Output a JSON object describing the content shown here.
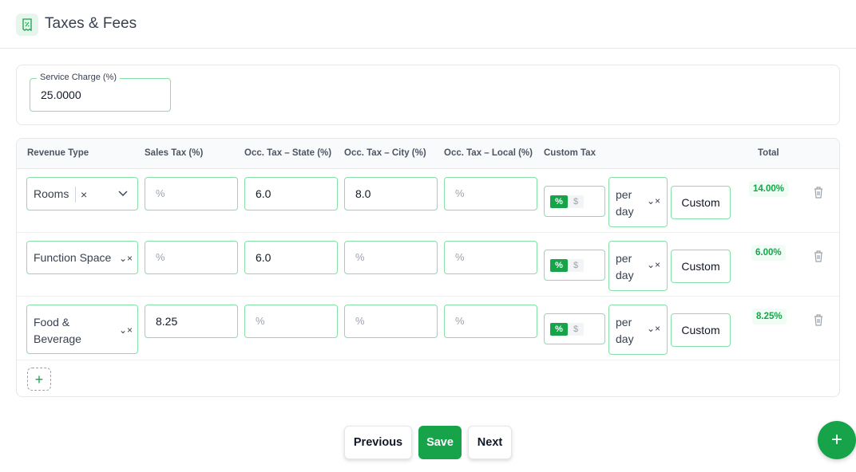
{
  "header": {
    "title": "Taxes & Fees",
    "icon": "receipt-icon"
  },
  "service_charge": {
    "label": "Service Charge (%)",
    "value": "25.0000"
  },
  "table": {
    "columns": [
      "Revenue Type",
      "Sales Tax (%)",
      "Occ. Tax – State (%)",
      "Occ. Tax – City (%)",
      "Occ. Tax – Local (%)",
      "Custom Tax",
      "Total"
    ],
    "placeholder": "%",
    "rows": [
      {
        "revenue_type": "Rooms",
        "sales_tax": "",
        "occ_state": "6.0",
        "occ_city": "8.0",
        "occ_local": "",
        "custom_unit": "%",
        "custom_unit_alt": "$",
        "frequency": "per day",
        "custom_label": "Custom",
        "total": "14.00%"
      },
      {
        "revenue_type": "Function Space",
        "sales_tax": "",
        "occ_state": "6.0",
        "occ_city": "",
        "occ_local": "",
        "custom_unit": "%",
        "custom_unit_alt": "$",
        "frequency": "per day",
        "custom_label": "Custom",
        "total": "6.00%"
      },
      {
        "revenue_type": "Food & Beverage",
        "sales_tax": "8.25",
        "occ_state": "",
        "occ_city": "",
        "occ_local": "",
        "custom_unit": "%",
        "custom_unit_alt": "$",
        "frequency": "per day",
        "custom_label": "Custom",
        "total": "8.25%"
      }
    ],
    "add_row": "+"
  },
  "footer": {
    "previous": "Previous",
    "save": "Save",
    "next": "Next",
    "fab": "+"
  },
  "colors": {
    "accent": "#16a34a",
    "field_border": "#86e0a8"
  }
}
